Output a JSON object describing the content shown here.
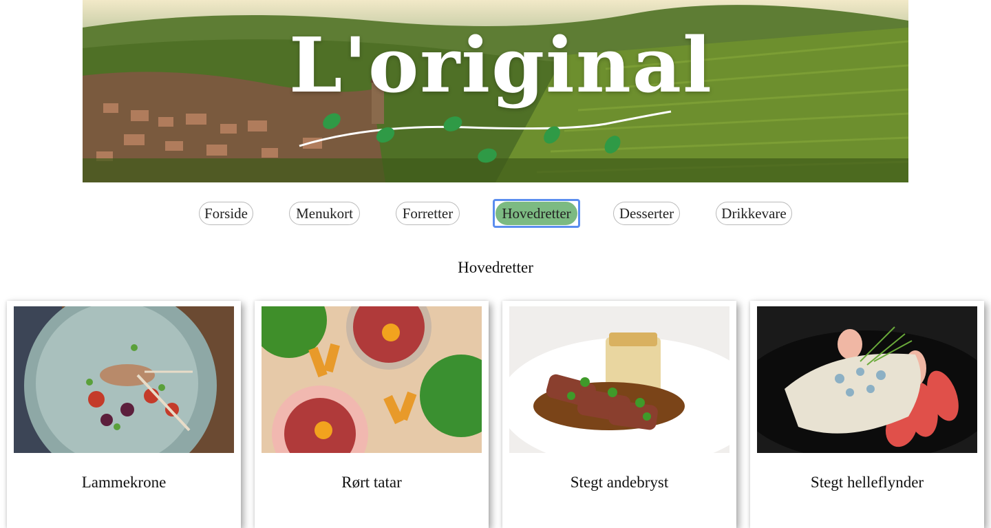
{
  "brand": {
    "logo_text": "L'original"
  },
  "nav": {
    "items": [
      {
        "label": "Forside",
        "active": false
      },
      {
        "label": "Menukort",
        "active": false
      },
      {
        "label": "Forretter",
        "active": false
      },
      {
        "label": "Hovedretter",
        "active": true
      },
      {
        "label": "Desserter",
        "active": false
      },
      {
        "label": "Drikkevare",
        "active": false
      }
    ],
    "active_color": "#7cba82",
    "focus_color": "#5b8def"
  },
  "section": {
    "title": "Hovedretter"
  },
  "dishes": [
    {
      "name": "Lammekrone",
      "image": "lamb-rack-photo"
    },
    {
      "name": "Rørt tatar",
      "image": "beef-tartare-photo"
    },
    {
      "name": "Stegt andebryst",
      "image": "duck-breast-photo"
    },
    {
      "name": "Stegt helleflynder",
      "image": "halibut-photo"
    }
  ]
}
